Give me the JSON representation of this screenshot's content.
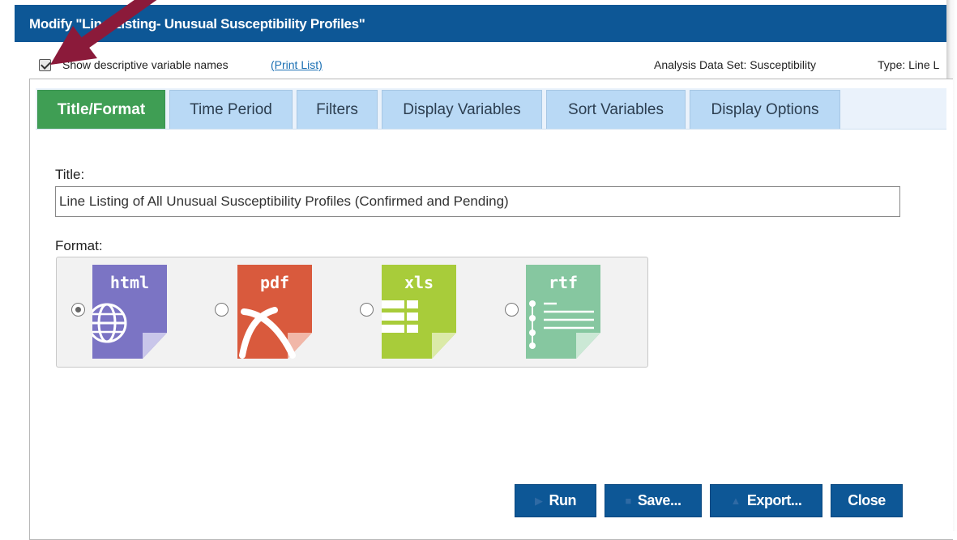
{
  "window": {
    "title": "Modify \"Line Listing- Unusual Susceptibility Profiles\""
  },
  "options": {
    "show_descriptive_names_label": "Show descriptive variable names",
    "show_descriptive_names_checked": true,
    "print_list_link": "(Print List)",
    "analysis_data_set_label": "Analysis Data Set:",
    "analysis_data_set_value": "Susceptibility",
    "type_label": "Type:",
    "type_value": "Line L"
  },
  "tabs": [
    {
      "label": "Title/Format",
      "active": true
    },
    {
      "label": "Time Period",
      "active": false
    },
    {
      "label": "Filters",
      "active": false
    },
    {
      "label": "Display Variables",
      "active": false
    },
    {
      "label": "Sort Variables",
      "active": false
    },
    {
      "label": "Display Options",
      "active": false
    }
  ],
  "form": {
    "title_label": "Title:",
    "title_value": "Line Listing of All Unusual Susceptibility Profiles (Confirmed and Pending)",
    "format_label": "Format:",
    "formats": [
      {
        "label": "html",
        "selected": true,
        "color": "#7b74c4",
        "icon": "globe-icon"
      },
      {
        "label": "pdf",
        "selected": false,
        "color": "#d95a3d",
        "icon": "acrobat-icon"
      },
      {
        "label": "xls",
        "selected": false,
        "color": "#a8cc3a",
        "icon": "spreadsheet-icon"
      },
      {
        "label": "rtf",
        "selected": false,
        "color": "#86c7a0",
        "icon": "text-lines-icon"
      }
    ]
  },
  "buttons": {
    "run": "Run",
    "save": "Save...",
    "export": "Export...",
    "close": "Close"
  },
  "colors": {
    "title_bar": "#0d5796",
    "active_tab": "#3f9e54",
    "inactive_tab": "#b9d9f5",
    "annotation_arrow": "#8b1a3a"
  }
}
